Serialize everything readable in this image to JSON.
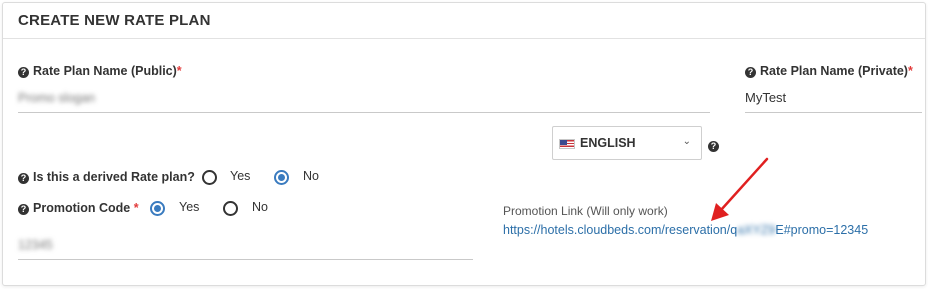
{
  "header": {
    "title": "CREATE NEW RATE PLAN"
  },
  "fields": {
    "public_name": {
      "label": "Rate Plan Name (Public)",
      "required_mark": "*",
      "value": "Promo slogan"
    },
    "private_name": {
      "label": "Rate Plan Name (Private)",
      "required_mark": "*",
      "value": "MyTest"
    },
    "language": {
      "selected": "ENGLISH",
      "flag_icon": "us-flag-icon",
      "chevron": "⌄"
    },
    "help_icon_glyph": "?",
    "derived": {
      "label": "Is this a derived Rate plan?",
      "options": [
        "Yes",
        "No"
      ],
      "selected": "No"
    },
    "promotion_code": {
      "label": "Promotion Code",
      "required_mark": "*",
      "options": [
        "Yes",
        "No"
      ],
      "selected": "Yes",
      "value": "12345"
    }
  },
  "promotion_link": {
    "label": "Promotion Link (Will only work)",
    "prefix": "https://hotels.cloudbeds.com/reservation/q",
    "hidden": "aXYZ9",
    "suffix": "E#promo=12345"
  },
  "colors": {
    "accent": "#3a7bbf",
    "required": "#e23b3b",
    "link": "#2c6fa8",
    "arrow": "#e02020"
  }
}
